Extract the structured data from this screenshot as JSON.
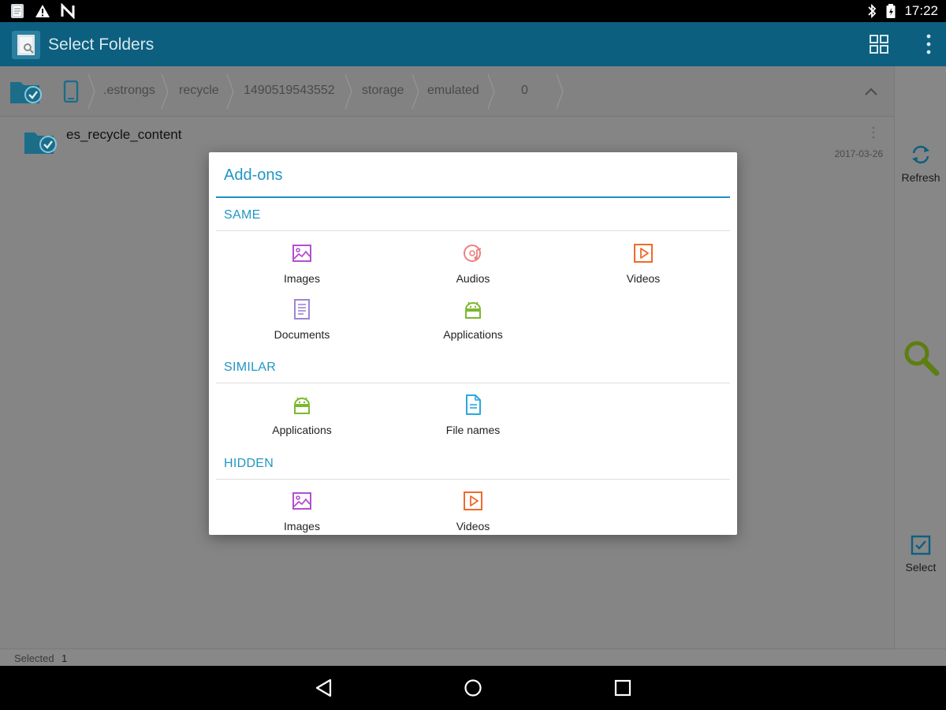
{
  "status_bar": {
    "time": "17:22"
  },
  "app_bar": {
    "title": "Select Folders"
  },
  "breadcrumb": {
    "segments": [
      ".estrongs",
      "recycle",
      "1490519543552",
      "storage",
      "emulated",
      "0"
    ]
  },
  "file_list": [
    {
      "name": "es_recycle_content",
      "date": "2017-03-26"
    }
  ],
  "side_panel": {
    "refresh_label": "Refresh",
    "select_label": "Select"
  },
  "footer": {
    "selected_label": "Selected",
    "selected_count": "1"
  },
  "dialog": {
    "title": "Add-ons",
    "sections": [
      {
        "heading": "SAME",
        "items": [
          "Images",
          "Audios",
          "Videos",
          "Documents",
          "Applications"
        ]
      },
      {
        "heading": "SIMILAR",
        "items": [
          "Applications",
          "File names"
        ]
      },
      {
        "heading": "HIDDEN",
        "items": [
          "Images",
          "Videos"
        ]
      }
    ]
  },
  "colors": {
    "accent": "#2196c4",
    "image_icon": "#b44fcf",
    "audio_icon": "#ee8080",
    "video_icon": "#f06a2a",
    "document_icon": "#9d86d6",
    "app_icon": "#7cb82f",
    "filename_icon": "#2aa8df",
    "search_icon": "#6b8f12"
  }
}
